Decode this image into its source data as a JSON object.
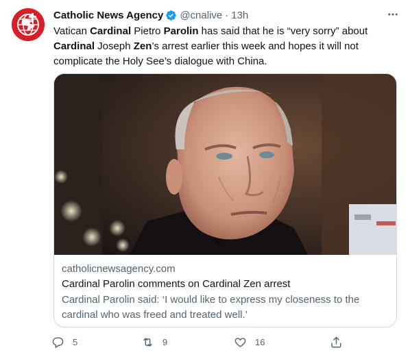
{
  "tweet": {
    "author_name": "Catholic News Agency",
    "handle": "@cnalive",
    "separator": "·",
    "time": "13h",
    "text_segments": [
      {
        "t": "Vatican ",
        "b": false
      },
      {
        "t": "Cardinal",
        "b": true
      },
      {
        "t": " Pietro ",
        "b": false
      },
      {
        "t": "Parolin",
        "b": true
      },
      {
        "t": " has said that he is “very sorry” about ",
        "b": false
      },
      {
        "t": "Cardinal",
        "b": true
      },
      {
        "t": " Joseph ",
        "b": false
      },
      {
        "t": "Zen",
        "b": true
      },
      {
        "t": "’s arrest earlier this week and hopes it will not complicate the Holy See’s dialogue with China.",
        "b": false
      }
    ]
  },
  "card": {
    "domain": "catholicnewsagency.com",
    "title": "Cardinal Parolin comments on Cardinal Zen arrest",
    "description": "Cardinal Parolin said: ‘I would like to express my closeness to the cardinal who was freed and treated well.’"
  },
  "actions": {
    "reply_count": "5",
    "retweet_count": "9",
    "like_count": "16"
  },
  "icons": {
    "avatar": "cna-logo-icon",
    "verified": "verified-badge-icon",
    "more": "more-icon",
    "reply": "reply-icon",
    "retweet": "retweet-icon",
    "like": "heart-icon",
    "share": "share-icon"
  },
  "colors": {
    "brand_red": "#d61f26",
    "verified_blue": "#1d9bf0",
    "secondary_text": "#536471",
    "border": "#cfd9de"
  }
}
